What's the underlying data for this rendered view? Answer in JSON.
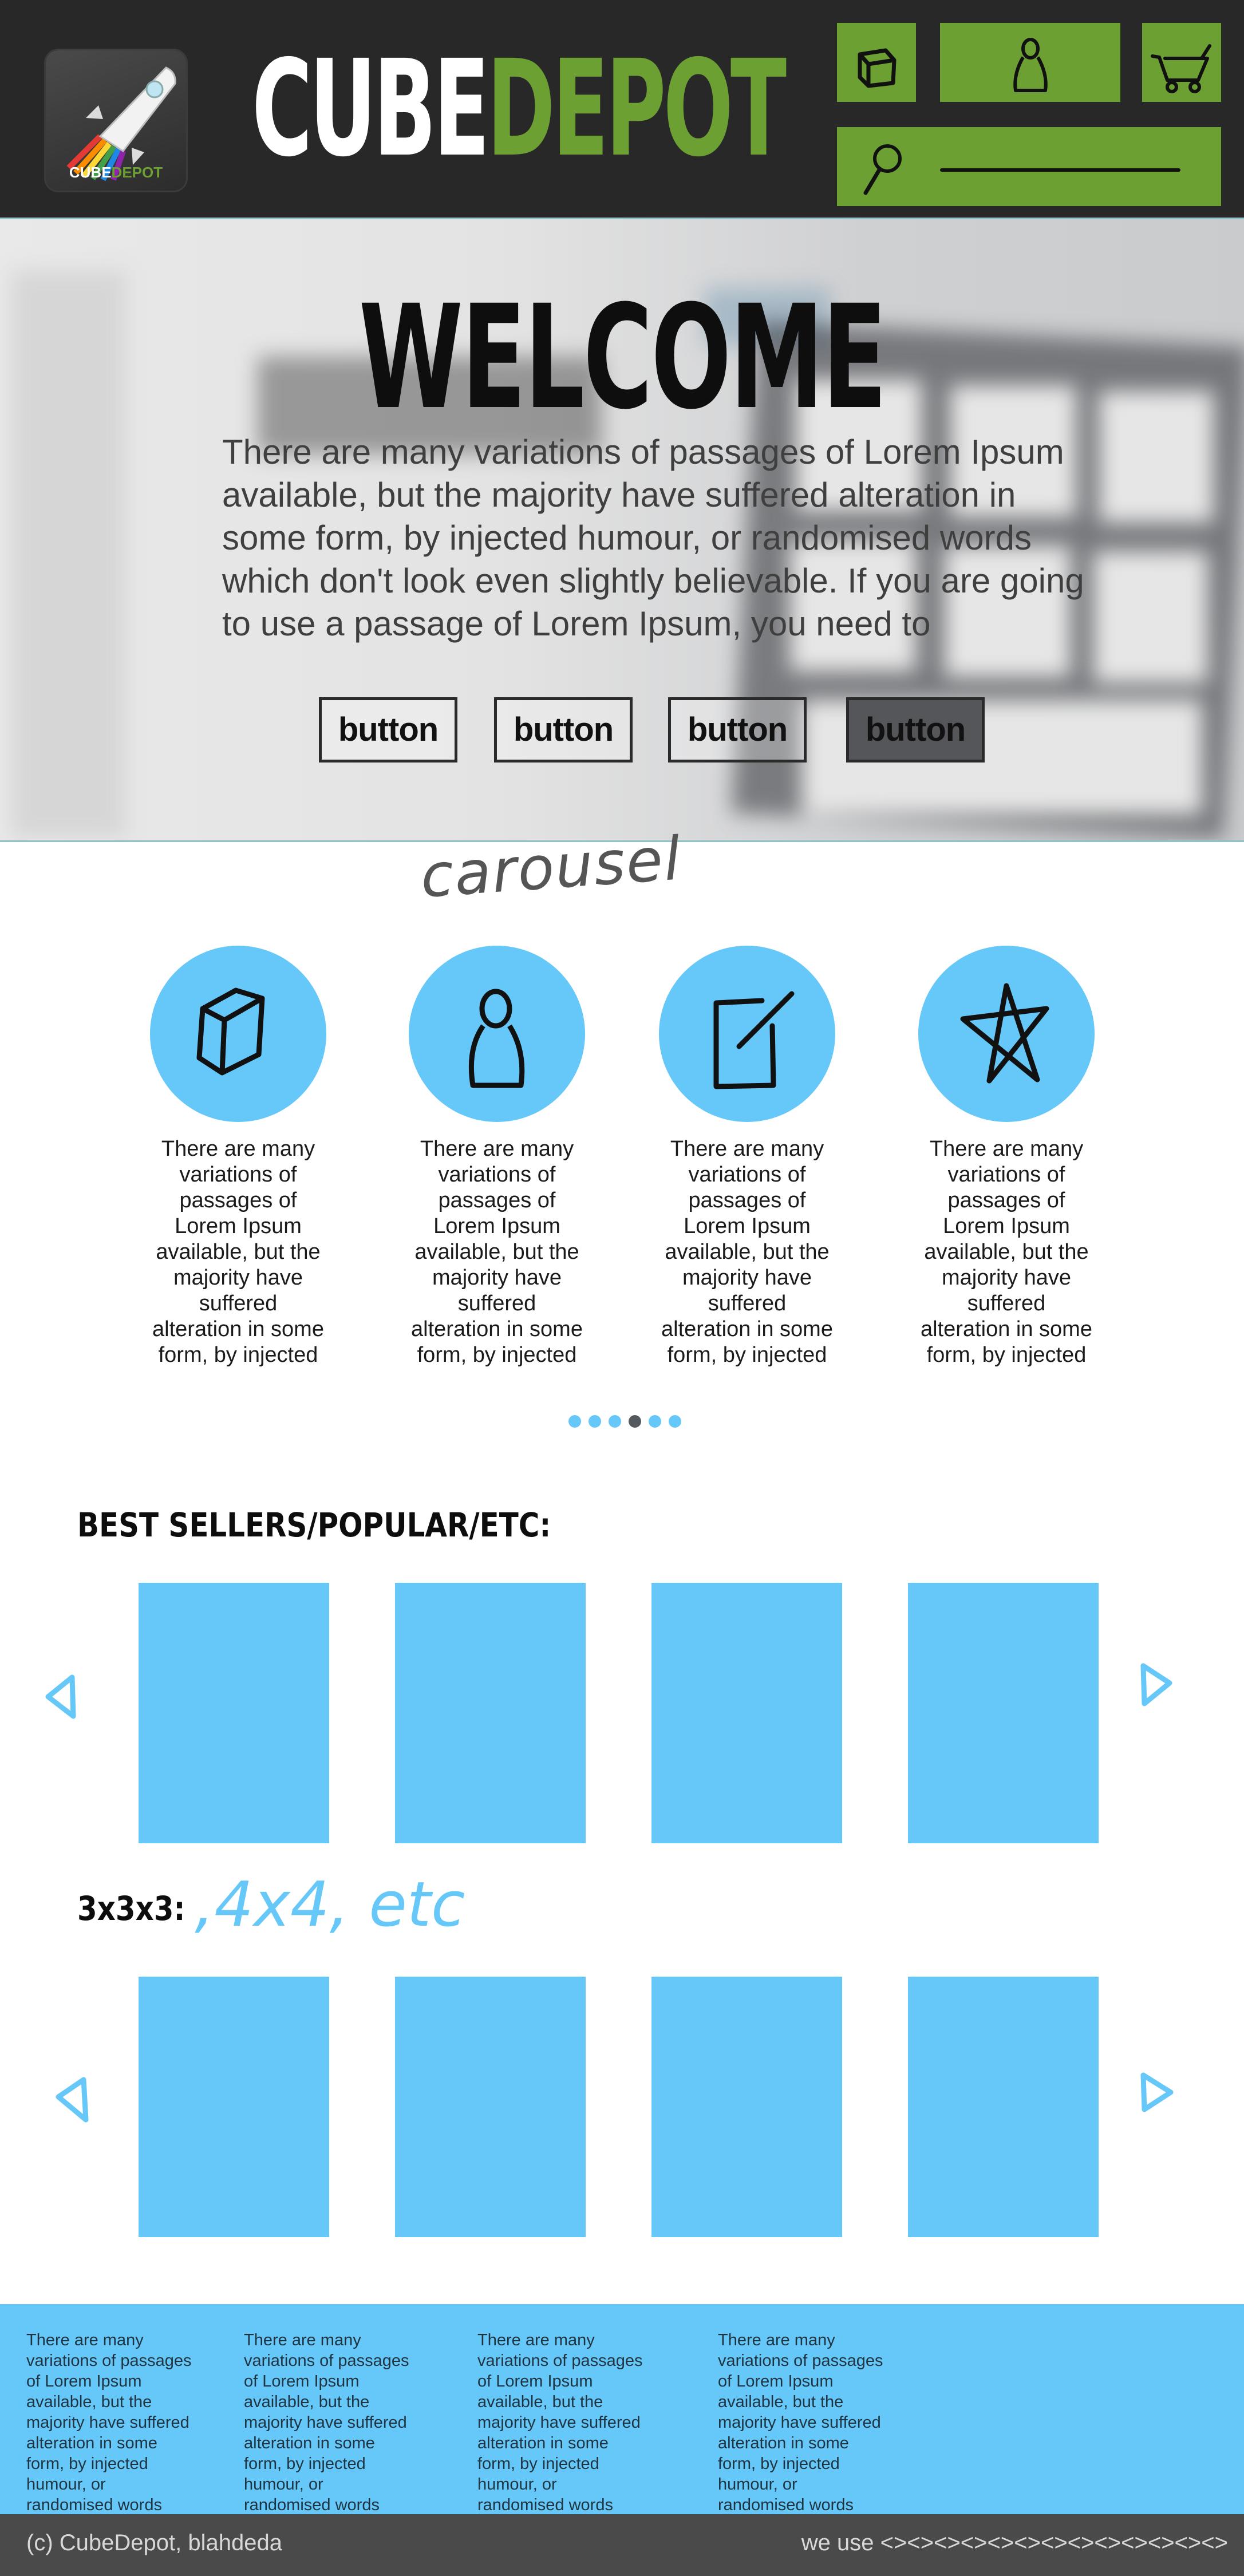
{
  "header": {
    "logo_text_a": "CUBE",
    "logo_text_b": "DEPOT",
    "brand_a": "CUBE",
    "brand_b": "DEPOT",
    "nav": [
      {
        "icon": "cube-icon"
      },
      {
        "icon": "account-icon"
      },
      {
        "icon": "cart-icon"
      }
    ],
    "search": {
      "icon": "search-icon"
    }
  },
  "hero": {
    "title": "WELCOME",
    "text": "There are many variations of passages of Lorem Ipsum available, but the majority have suffered alteration in some form, by injected humour, or randomised words which don't look even slightly believable. If you are going to use a passage of Lorem Ipsum, you need to",
    "buttons": [
      "button",
      "button",
      "button",
      "button"
    ]
  },
  "carousel": {
    "label": "carousel",
    "items": [
      {
        "icon": "cube-icon",
        "text": "There are many variations of passages of Lorem Ipsum available, but the majority have suffered alteration in some form, by injected"
      },
      {
        "icon": "person-icon",
        "text": "There are many variations of passages of Lorem Ipsum available, but the majority have suffered alteration in some form, by injected"
      },
      {
        "icon": "edit-icon",
        "text": "There are many variations of passages of Lorem Ipsum available, but the majority have suffered alteration in some form, by injected"
      },
      {
        "icon": "star-icon",
        "text": "There are many variations of passages of Lorem Ipsum available, but the majority have suffered alteration in some form, by injected"
      }
    ],
    "dots_total": 6,
    "dots_active": 4
  },
  "best_sellers": {
    "title": "BEST SELLERS/POPULAR/ETC:"
  },
  "row2": {
    "title": "3x3x3:",
    "note": ",4x4, etc"
  },
  "footer": {
    "columns": [
      "There are many variations of passages of Lorem Ipsum available, but the majority have suffered alteration in some form, by injected humour, or randomised words",
      "There are many variations of passages of Lorem Ipsum available, but the majority have suffered alteration in some form, by injected humour, or randomised words",
      "There are many variations of passages of Lorem Ipsum available, but the majority have suffered alteration in some form, by injected humour, or randomised words",
      "There are many variations of passages of Lorem Ipsum available, but the majority have suffered alteration in some form, by injected humour, or randomised words"
    ],
    "copyright": "(c) CubeDepot, blahdeda",
    "tech": "we use <><><><><><><><><><><><><>"
  },
  "colors": {
    "header_bg": "#282828",
    "brand_green": "#6ca033",
    "accent_blue": "#66c8f9",
    "bottom_bar": "#4a4a4a"
  }
}
